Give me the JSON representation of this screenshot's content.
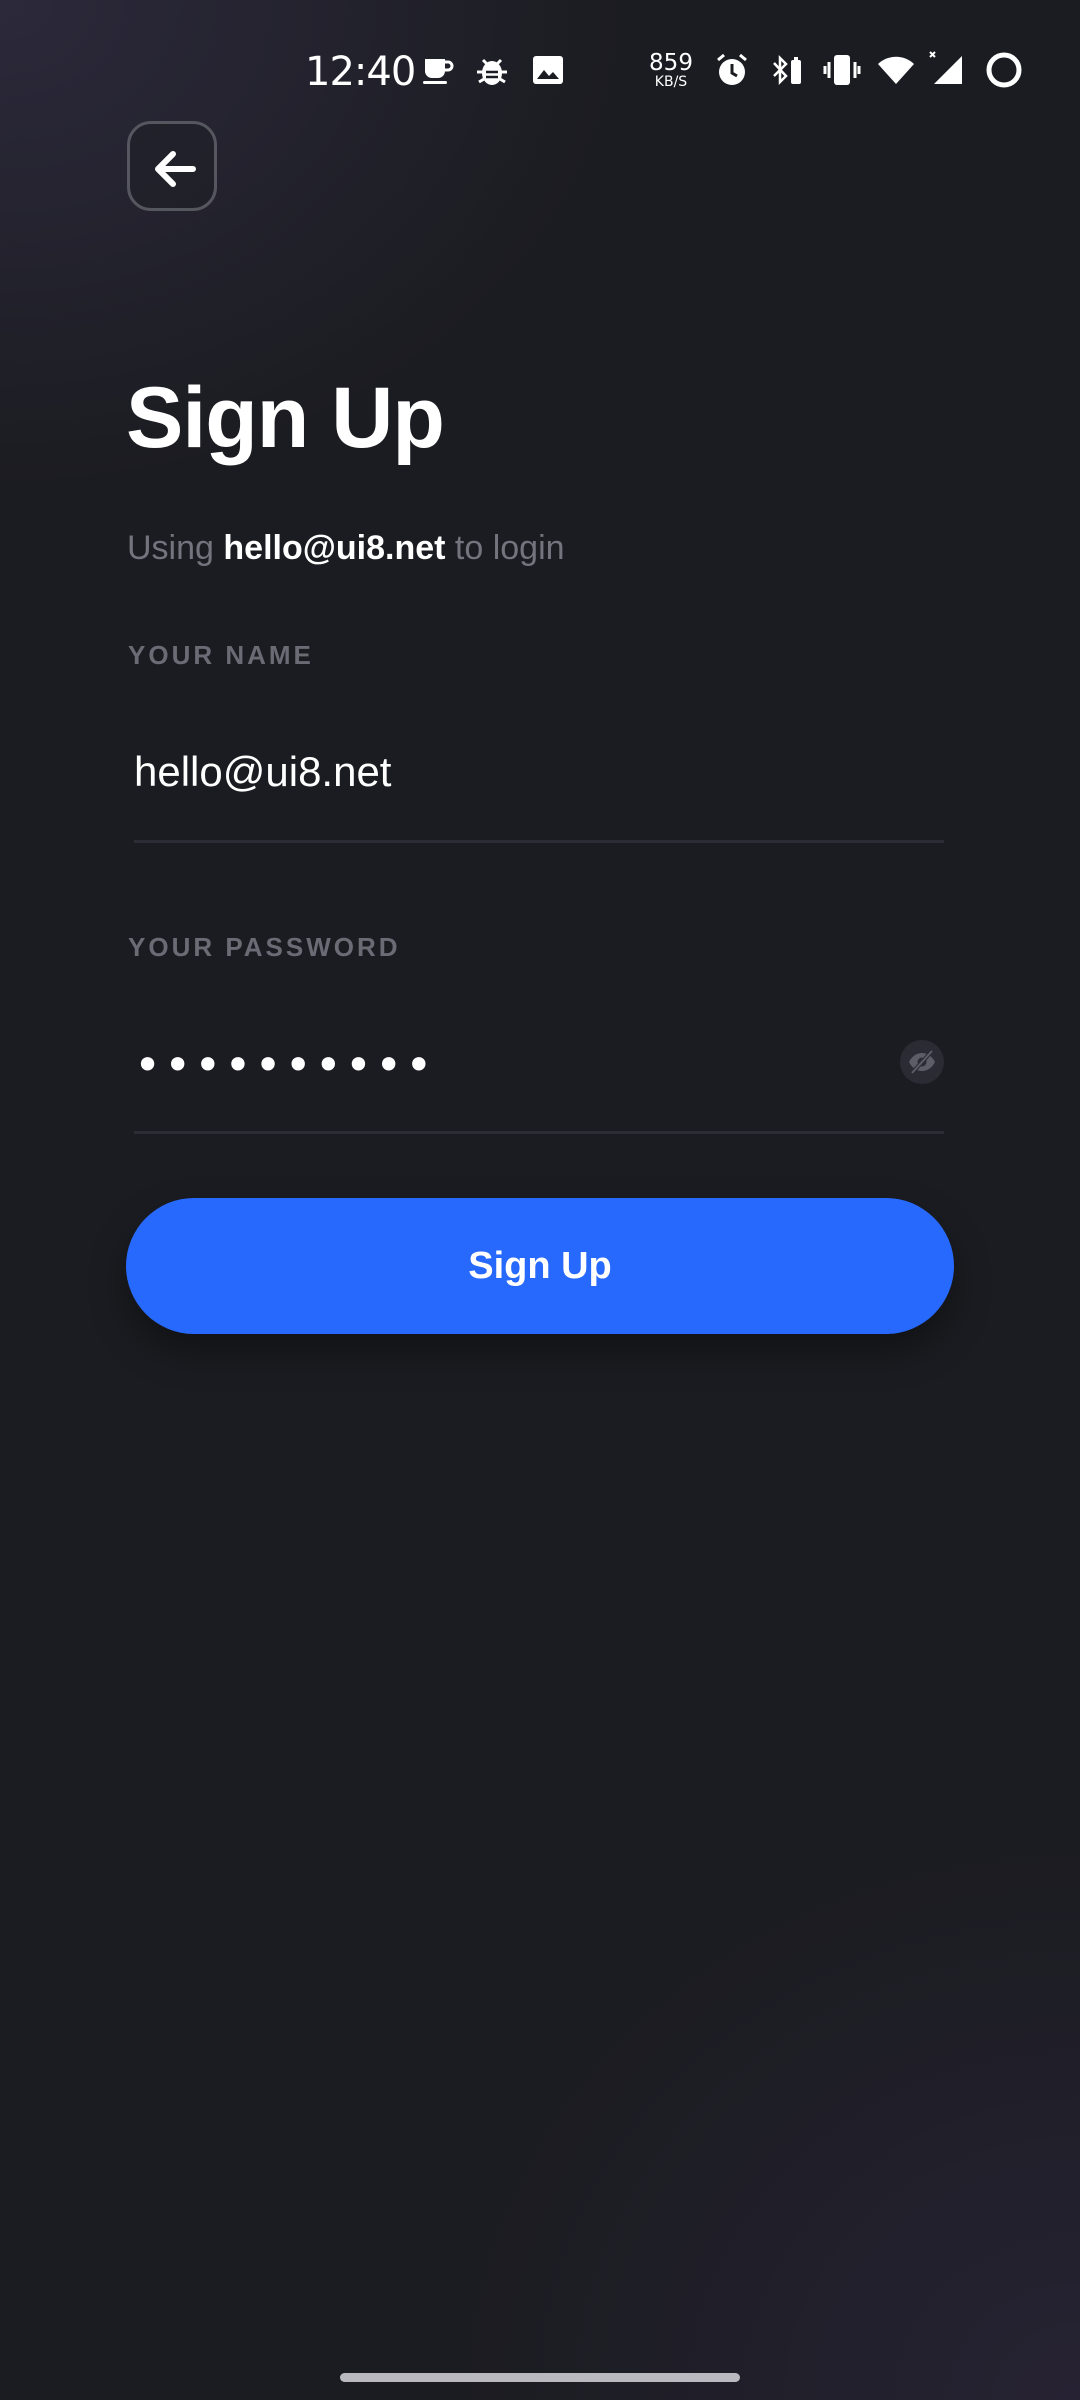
{
  "status_bar": {
    "time": "12:40",
    "network_speed_value": "859",
    "network_speed_unit": "KB/S",
    "icons": [
      "coffee-icon",
      "bug-icon",
      "image-icon",
      "alarm-icon",
      "bluetooth-battery-icon",
      "vibrate-icon",
      "wifi-icon",
      "signal-icon",
      "battery-ring-icon"
    ]
  },
  "header": {
    "back_icon": "arrow-left-icon"
  },
  "title": "Sign Up",
  "subtitle": {
    "prefix": "Using",
    "email": "hello@ui8.net",
    "suffix": "to login"
  },
  "form": {
    "name_label": "YOUR NAME",
    "name_value": "hello@ui8.net",
    "password_label": "YOUR PASSWORD",
    "password_masked": "••••••••••",
    "password_toggle_icon": "eye-off-icon"
  },
  "primary_button": {
    "label": "Sign Up",
    "color": "#2769fc"
  },
  "colors": {
    "background": "#1b1c21",
    "muted_text": "#73747d",
    "accent": "#2769fc"
  }
}
